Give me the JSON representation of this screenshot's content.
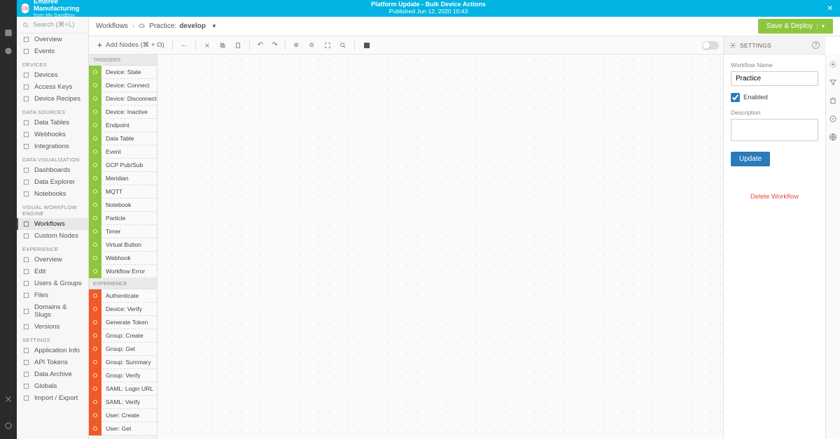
{
  "banner": {
    "title": "Platform Update - Bulk Device Actions",
    "subtitle": "Published Jun 12, 2020 10:43"
  },
  "org": {
    "name": "Embree Manufacturing",
    "sub": "from My Sandbox",
    "initials": "EM"
  },
  "search": {
    "placeholder": "Search (⌘+L)"
  },
  "sidebar": {
    "top": [
      {
        "label": "Overview"
      },
      {
        "label": "Events"
      }
    ],
    "sections": [
      {
        "title": "DEVICES",
        "items": [
          {
            "label": "Devices"
          },
          {
            "label": "Access Keys"
          },
          {
            "label": "Device Recipes"
          }
        ]
      },
      {
        "title": "DATA SOURCES",
        "items": [
          {
            "label": "Data Tables"
          },
          {
            "label": "Webhooks"
          },
          {
            "label": "Integrations"
          }
        ]
      },
      {
        "title": "DATA VISUALIZATION",
        "items": [
          {
            "label": "Dashboards"
          },
          {
            "label": "Data Explorer"
          },
          {
            "label": "Notebooks"
          }
        ]
      },
      {
        "title": "VISUAL WORKFLOW ENGINE",
        "items": [
          {
            "label": "Workflows",
            "active": true
          },
          {
            "label": "Custom Nodes"
          }
        ]
      },
      {
        "title": "EXPERIENCE",
        "items": [
          {
            "label": "Overview"
          },
          {
            "label": "Edit"
          },
          {
            "label": "Users & Groups"
          },
          {
            "label": "Files"
          },
          {
            "label": "Domains & Slugs"
          },
          {
            "label": "Versions"
          }
        ]
      },
      {
        "title": "SETTINGS",
        "items": [
          {
            "label": "Application Info"
          },
          {
            "label": "API Tokens"
          },
          {
            "label": "Data Archive"
          },
          {
            "label": "Globals"
          },
          {
            "label": "Import / Export"
          }
        ]
      }
    ]
  },
  "breadcrumb": {
    "root": "Workflows",
    "workflow": "Practice:",
    "branch": "develop"
  },
  "toolbar": {
    "add": "Add Nodes (⌘ + O)",
    "save": "Save & Deploy"
  },
  "palette": {
    "triggers_title": "TRIGGERS",
    "triggers": [
      "Device: State",
      "Device: Connect",
      "Device: Disconnect",
      "Device: Inactive",
      "Endpoint",
      "Data Table",
      "Event",
      "GCP Pub/Sub",
      "Meridian",
      "MQTT",
      "Notebook",
      "Particle",
      "Timer",
      "Virtual Button",
      "Webhook",
      "Workflow Error"
    ],
    "experience_title": "EXPERIENCE",
    "experience": [
      "Authenticate",
      "Device: Verify",
      "Generate Token",
      "Group: Create",
      "Group: Get",
      "Group: Summary",
      "Group: Verify",
      "SAML: Login URL",
      "SAML: Verify",
      "User: Create",
      "User: Get"
    ]
  },
  "settings": {
    "header": "SETTINGS",
    "name_label": "Workflow Name",
    "name_value": "Practice",
    "enabled_label": "Enabled",
    "enabled": true,
    "desc_label": "Description",
    "update": "Update",
    "delete": "Delete Workflow"
  }
}
